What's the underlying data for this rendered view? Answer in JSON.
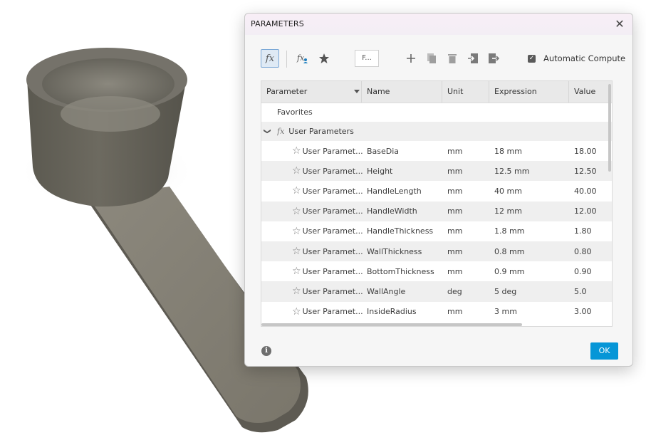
{
  "dialog": {
    "title": "PARAMETERS",
    "close_label": "✕"
  },
  "toolbar": {
    "fx_label": "fx",
    "filter_text": "F...",
    "auto_compute_label": "Automatic Compute",
    "auto_compute_checked": true,
    "icons": [
      "fx-icon",
      "user-fx-icon",
      "star-icon",
      "add-icon",
      "copy-icon",
      "delete-icon",
      "import-icon",
      "export-icon"
    ]
  },
  "grid": {
    "columns": [
      "Parameter",
      "Name",
      "Unit",
      "Expression",
      "Value"
    ],
    "favorites_label": "Favorites",
    "group_label": "User Parameters",
    "rows": [
      {
        "param": "User Paramet...",
        "name": "BaseDia",
        "unit": "mm",
        "expr": "18 mm",
        "value": "18.00"
      },
      {
        "param": "User Paramet...",
        "name": "Height",
        "unit": "mm",
        "expr": "12.5 mm",
        "value": "12.50"
      },
      {
        "param": "User Paramet...",
        "name": "HandleLength",
        "unit": "mm",
        "expr": "40 mm",
        "value": "40.00"
      },
      {
        "param": "User Paramet...",
        "name": "HandleWidth",
        "unit": "mm",
        "expr": "12 mm",
        "value": "12.00"
      },
      {
        "param": "User Paramet...",
        "name": "HandleThickness",
        "unit": "mm",
        "expr": "1.8 mm",
        "value": "1.80"
      },
      {
        "param": "User Paramet...",
        "name": "WallThickness",
        "unit": "mm",
        "expr": "0.8 mm",
        "value": "0.80"
      },
      {
        "param": "User Paramet...",
        "name": "BottomThickness",
        "unit": "mm",
        "expr": "0.9 mm",
        "value": "0.90"
      },
      {
        "param": "User Paramet...",
        "name": "WallAngle",
        "unit": "deg",
        "expr": "5 deg",
        "value": "5.0"
      },
      {
        "param": "User Paramet...",
        "name": "InsideRadius",
        "unit": "mm",
        "expr": "3 mm",
        "value": "3.00"
      }
    ]
  },
  "footer": {
    "info_label": "i",
    "ok_label": "OK"
  },
  "colors": {
    "accent": "#0696d7",
    "model": "#6e6b61"
  }
}
